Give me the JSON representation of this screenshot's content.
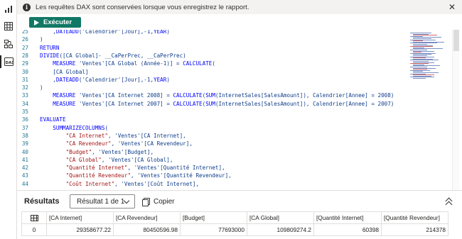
{
  "infobar": {
    "message": "Les requêtes DAX sont conservées lorsque vous enregistrez le rapport."
  },
  "toolbar": {
    "run_label": "Exécuter"
  },
  "rail": {
    "items": [
      {
        "icon": "report-view-icon"
      },
      {
        "icon": "table-view-icon"
      },
      {
        "icon": "model-view-icon"
      },
      {
        "icon": "dax-query-view-icon",
        "active": true
      }
    ]
  },
  "editor": {
    "lines": [
      {
        "num": "25",
        "text": "    ,DATEADD('Calendrier'[Jour],-1,YEAR)"
      },
      {
        "num": "26",
        "text": ")"
      },
      {
        "num": "27",
        "text": "RETURN"
      },
      {
        "num": "28",
        "text": "DIVIDE([CA Global]- __CaPerPrec, __CaPerPrec)"
      },
      {
        "num": "29",
        "text": "    MEASURE 'Ventes'[CA Global (Année-1)] = CALCULATE("
      },
      {
        "num": "30",
        "text": "    [CA Global]"
      },
      {
        "num": "31",
        "text": "    ,DATEADD('Calendrier'[Jour],-1,YEAR)"
      },
      {
        "num": "32",
        "text": ")"
      },
      {
        "num": "33",
        "text": "    MEASURE 'Ventes'[CA Internet 2008] = CALCULATE(SUM(InternetSales[SalesAmount]), Calendrier[Annee] = 2008)"
      },
      {
        "num": "34",
        "text": "    MEASURE 'Ventes'[CA Internet 2007] = CALCULATE(SUM(InternetSales[SalesAmount]), Calendrier[Annee] = 2007)"
      },
      {
        "num": "35",
        "text": ""
      },
      {
        "num": "36",
        "text": "EVALUATE"
      },
      {
        "num": "37",
        "text": "    SUMMARIZECOLUMNS("
      },
      {
        "num": "38",
        "text": "        \"CA Internet\", 'Ventes'[CA Internet],"
      },
      {
        "num": "39",
        "text": "        \"CA Revendeur\", 'Ventes'[CA Revendeur],"
      },
      {
        "num": "40",
        "text": "        \"Budget\", 'Ventes'[Budget],"
      },
      {
        "num": "41",
        "text": "        \"CA Global\", 'Ventes'[CA Global],"
      },
      {
        "num": "42",
        "text": "        \"Quantité Internet\", 'Ventes'[Quantité Internet],"
      },
      {
        "num": "43",
        "text": "        \"Quantité Revendeur\", 'Ventes'[Quantité Revendeur],"
      },
      {
        "num": "44",
        "text": "        \"Coût Internet\", 'Ventes'[Coût Internet],"
      }
    ]
  },
  "results": {
    "title": "Résultats",
    "selected": "Résultat 1 de 1",
    "copy_label": "Copier",
    "columns": [
      "[CA Internet]",
      "[CA Revendeur]",
      "[Budget]",
      "[CA Global]",
      "[Quantité Internet]",
      "[Quantité Revendeur]"
    ],
    "rows": [
      {
        "index": "0",
        "values": [
          "29358677.22",
          "80450596.98",
          "77693000",
          "109809274.2",
          "60398",
          "214378"
        ]
      }
    ]
  }
}
